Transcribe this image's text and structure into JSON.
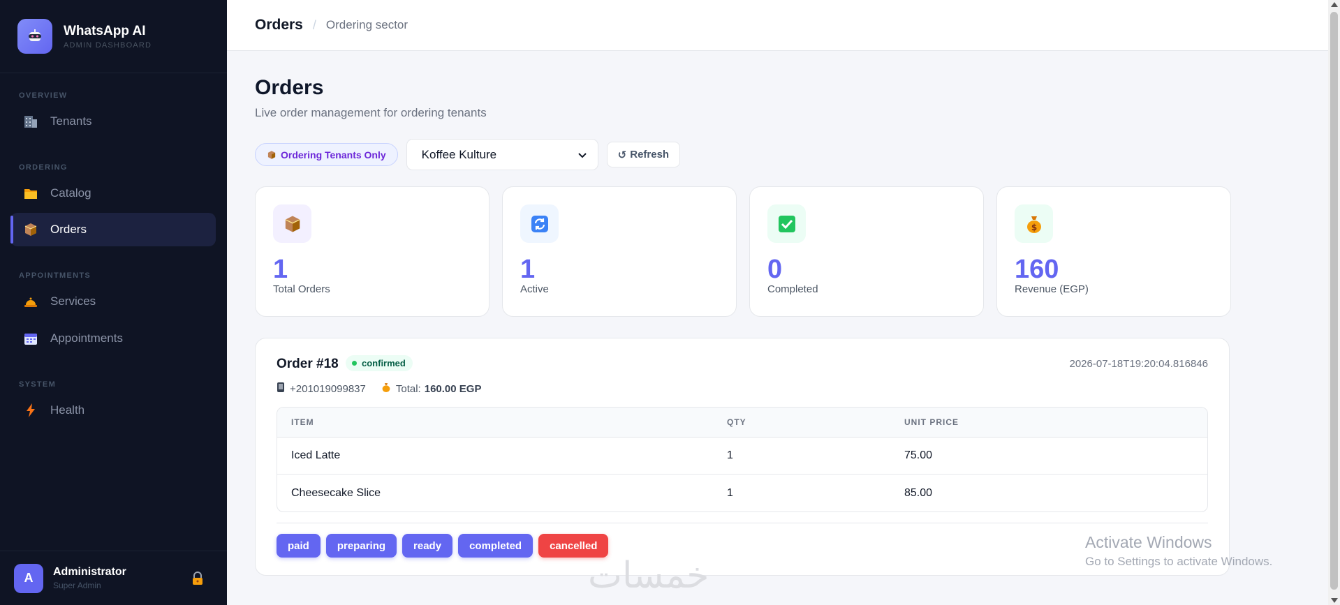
{
  "sidebar": {
    "brand_title": "WhatsApp AI",
    "brand_subtitle": "ADMIN DASHBOARD",
    "sections": {
      "overview": "OVERVIEW",
      "ordering": "ORDERING",
      "appointments": "APPOINTMENTS",
      "system": "SYSTEM"
    },
    "items": {
      "tenants": "Tenants",
      "catalog": "Catalog",
      "orders": "Orders",
      "services": "Services",
      "appointments": "Appointments",
      "health": "Health"
    },
    "active_item": "Orders",
    "user": {
      "initial": "A",
      "name": "Administrator",
      "role": "Super Admin"
    }
  },
  "topbar": {
    "title": "Orders",
    "subtitle": "Ordering sector"
  },
  "page": {
    "title": "Orders",
    "subtitle": "Live order management for ordering tenants"
  },
  "filters": {
    "pill_label": "Ordering Tenants Only",
    "tenant_selected": "Koffee Kulture",
    "refresh_label": "Refresh"
  },
  "stats": [
    {
      "value": "1",
      "label": "Total Orders",
      "icon": "package-icon",
      "icon_bg": "#f3f0ff"
    },
    {
      "value": "1",
      "label": "Active",
      "icon": "refresh-icon",
      "icon_bg": "#eff6ff"
    },
    {
      "value": "0",
      "label": "Completed",
      "icon": "checkmark-icon",
      "icon_bg": "#ecfdf5"
    },
    {
      "value": "160",
      "label": "Revenue (EGP)",
      "icon": "money-bag-icon",
      "icon_bg": "#ecfdf5"
    }
  ],
  "order": {
    "title": "Order #18",
    "status": "confirmed",
    "timestamp": "2026-07-18T19:20:04.816846",
    "phone": "+201019099837",
    "total_label": "Total:",
    "total_value": "160.00 EGP",
    "columns": {
      "item": "ITEM",
      "qty": "QTY",
      "price": "UNIT PRICE"
    },
    "items": [
      {
        "name": "Iced Latte",
        "qty": "1",
        "price": "75.00"
      },
      {
        "name": "Cheesecake Slice",
        "qty": "1",
        "price": "85.00"
      }
    ],
    "actions": {
      "paid": "paid",
      "preparing": "preparing",
      "ready": "ready",
      "completed": "completed",
      "cancelled": "cancelled"
    }
  },
  "overlay": {
    "activate_title": "Activate Windows",
    "activate_sub": "Go to Settings to activate Windows.",
    "watermark": "خمسات"
  },
  "colors": {
    "accent": "#6366f1",
    "danger": "#ef4444",
    "sidebar_bg": "#0f1424",
    "success": "#22c55e"
  }
}
